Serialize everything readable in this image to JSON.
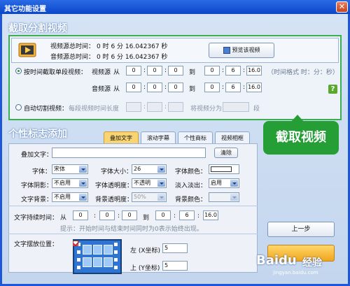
{
  "window": {
    "title": "其它功能设置",
    "close": "✕"
  },
  "capture": {
    "section_title": "截取分割视频",
    "video_total_label": "视频源总时间：",
    "video_total_value": "0  时 6  分 16.042367 秒",
    "audio_total_label": "音频源总时间：",
    "audio_total_value": "0  时 6  分 16.042367 秒",
    "preview_button": "预览该视频",
    "mode_time_label": "按时间截取单段视频：",
    "video_source_label": "视频源",
    "audio_source_label": "音频源",
    "from_label": "从",
    "to_label": "到",
    "video_from": [
      "0",
      "0",
      "0"
    ],
    "video_to": [
      "0",
      "6",
      "16.0"
    ],
    "audio_from": [
      "0",
      "0",
      "0"
    ],
    "audio_to": [
      "0",
      "6",
      "16.0"
    ],
    "time_format_hint": "（时间格式 时：分：秒）",
    "help_icon": "?",
    "auto_cut_label": "自动切割视频：",
    "segment_length_label": "每段视频时间长度",
    "split_into_label": "将视频分为",
    "segment_unit": "段",
    "seps": [
      ":",
      ":"
    ]
  },
  "callout": {
    "text": "截取视频"
  },
  "logo_section": {
    "title": "个性标志添加",
    "tabs": [
      "叠加文字",
      "滚动字幕",
      "个性商标",
      "视频相框"
    ],
    "overlay_text_label": "叠加文字：",
    "overlay_text_value": "",
    "clear_button": "清除",
    "font_label": "字体：",
    "font_value": "宋体",
    "font_size_label": "字体大小：",
    "font_size_value": "26",
    "font_color_label": "字体颜色：",
    "font_shadow_label": "字体阴影：",
    "font_shadow_value": "不启用",
    "font_opacity_label": "字体透明度：",
    "font_opacity_value": "不透明",
    "fade_label": "淡入淡出：",
    "fade_value": "启用",
    "text_bg_label": "文字背景：",
    "text_bg_value": "不启用",
    "bg_opacity_label": "背景透明度：",
    "bg_opacity_value": "50%",
    "bg_color_label": "背景颜色：",
    "duration_label": "文字持续时间：",
    "duration_from": [
      "0",
      "0",
      "0"
    ],
    "duration_to": [
      "0",
      "6",
      "16.0"
    ],
    "hint": "提示：开始时间与结束时间同时为0表示始终出现。",
    "position_label": "文字摆放位置：",
    "left_label": "左 (X坐标)",
    "left_value": "5",
    "top_label": "上 (Y坐标)",
    "top_value": "5"
  },
  "buttons": {
    "prev": "上一步"
  },
  "watermark": {
    "brand": "Baidu",
    "suffix": "经验",
    "site": "jingyan.baidu.com"
  }
}
